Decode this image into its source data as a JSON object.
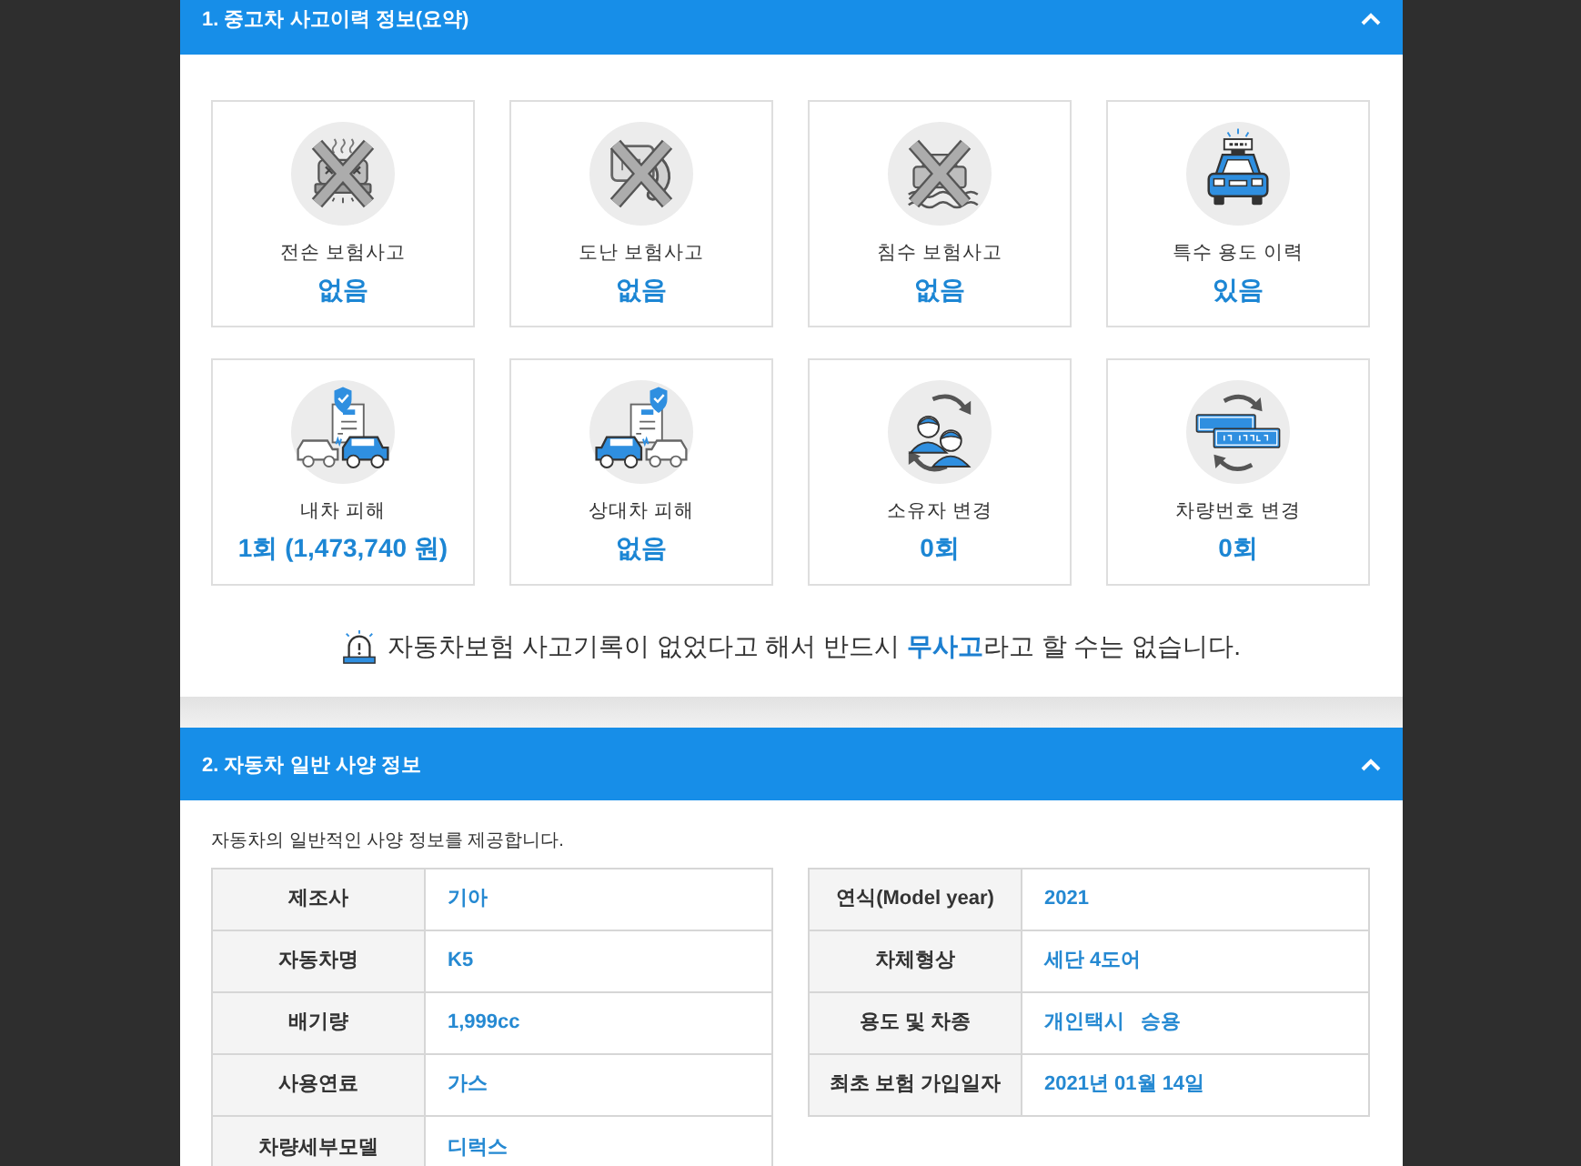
{
  "accident_summary": {
    "title": "1. 중고차 사고이력 정보(요약)",
    "expanded": true,
    "cards": [
      {
        "kind": "total-loss",
        "crossed_out": true,
        "label": "전손 보험사고",
        "value": "없음"
      },
      {
        "kind": "theft",
        "crossed_out": true,
        "label": "도난 보험사고",
        "value": "없음"
      },
      {
        "kind": "flood",
        "crossed_out": true,
        "label": "침수 보험사고",
        "value": "없음"
      },
      {
        "kind": "special-use",
        "crossed_out": false,
        "label": "특수 용도 이력",
        "value": "있음"
      },
      {
        "kind": "own-damage",
        "crossed_out": false,
        "label": "내차 피해",
        "value": "1회 (1,473,740 원)"
      },
      {
        "kind": "other-damage",
        "crossed_out": false,
        "label": "상대차 피해",
        "value": "없음"
      },
      {
        "kind": "owner-change",
        "crossed_out": false,
        "label": "소유자 변경",
        "value": "0회"
      },
      {
        "kind": "plate-change",
        "crossed_out": false,
        "label": "차량번호 변경",
        "value": "0회"
      }
    ],
    "notice": "자동차보험 사고기록이 없었다고 해서 반드시 **무사고**라고 할 수는 없습니다."
  },
  "spec_info": {
    "title": "2. 자동차 일반 사양 정보",
    "expanded": true,
    "description": "자동차의 일반적인 사양 정보를 제공합니다.",
    "tables": [
      [
        {
          "label": "제조사",
          "value": "기아"
        },
        {
          "label": "자동차명",
          "value": "K5"
        },
        {
          "label": "배기량",
          "value": "1,999cc"
        },
        {
          "label": "사용연료",
          "value": "가스"
        },
        {
          "label": "차량세부모델",
          "value": "디럭스"
        }
      ],
      [
        {
          "label": "연식(Model year)",
          "value": "2021"
        },
        {
          "label": "차체형상",
          "value": "세단 4도어"
        },
        {
          "label": "용도 및 차종",
          "value": "개인택시   승용"
        },
        {
          "label": "최초 보험 가입일자",
          "value": "2021년 01월 14일"
        }
      ]
    ]
  }
}
